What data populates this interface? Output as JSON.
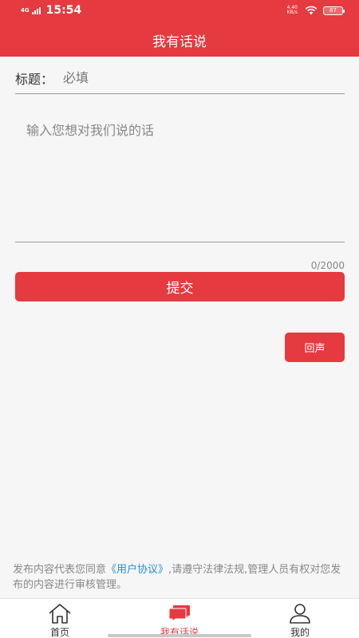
{
  "status_bar": {
    "network": "4G",
    "time": "15:54",
    "speed_value": "4.40",
    "speed_unit": "KB/s",
    "battery": "87"
  },
  "header": {
    "title": "我有话说"
  },
  "form": {
    "title_label": "标题：",
    "title_placeholder": "必填",
    "content_placeholder": "输入您想对我们说的话",
    "counter": "0/2000",
    "submit_label": "提交",
    "echo_label": "回声"
  },
  "notice": {
    "text_before": "发布内容代表您同意",
    "link": "《用户协议》",
    "text_after": ",请遵守法律法规,管理人员有权对您发布的内容进行审核管理。"
  },
  "tabs": [
    {
      "label": "首页",
      "icon": "home-icon",
      "active": false
    },
    {
      "label": "我有话说",
      "icon": "chat-icon",
      "active": true
    },
    {
      "label": "我的",
      "icon": "user-icon",
      "active": false
    }
  ],
  "colors": {
    "accent": "#e53a3f",
    "link": "#2a8fd6"
  }
}
